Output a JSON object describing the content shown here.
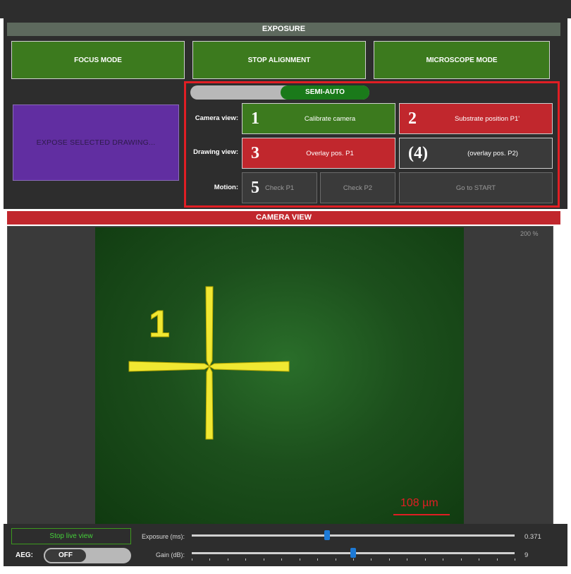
{
  "exposure_section": {
    "title": "EXPOSURE",
    "focus_mode_label": "FOCUS MODE",
    "stop_alignment_label": "STOP ALIGNMENT",
    "microscope_mode_label": "MICROSCOPE MODE",
    "expose_drawing_label": "EXPOSE SELECTED DRAWING..."
  },
  "alignment": {
    "mode_toggle_label": "SEMI-AUTO",
    "rows": [
      {
        "label": "Camera view:"
      },
      {
        "label": "Drawing view:"
      },
      {
        "label": "Motion:"
      }
    ],
    "buttons": {
      "calibrate": {
        "num": "1",
        "label": "Calibrate camera",
        "color": "#3c7a1e"
      },
      "substrate": {
        "num": "2",
        "label": "Substrate position P1'",
        "color": "#c1272d"
      },
      "overlay_p1": {
        "num": "3",
        "label": "Overlay pos. P1",
        "color": "#c1272d"
      },
      "overlay_p2": {
        "num": "(4)",
        "label": "(overlay pos. P2)"
      },
      "check_p1": {
        "num": "5",
        "label": "Check P1"
      },
      "check_p2": {
        "label": "Check P2"
      },
      "go_start": {
        "label": "Go to START"
      }
    }
  },
  "camera_view": {
    "title": "CAMERA VIEW",
    "zoom": "200 %",
    "marker_label": "1",
    "scale_label": "108 µm"
  },
  "controls": {
    "stop_live_label": "Stop live view",
    "aeg_label": "AEG:",
    "aeg_state": "OFF",
    "exposure": {
      "label": "Exposure (ms):",
      "value": "0.371",
      "level": 0.42
    },
    "gain": {
      "label": "Gain (dB):",
      "value": "9",
      "level": 0.5
    }
  },
  "colors": {
    "accent_red": "#c1272d",
    "accent_green": "#3c7a1e",
    "cross": "#f0e832"
  }
}
